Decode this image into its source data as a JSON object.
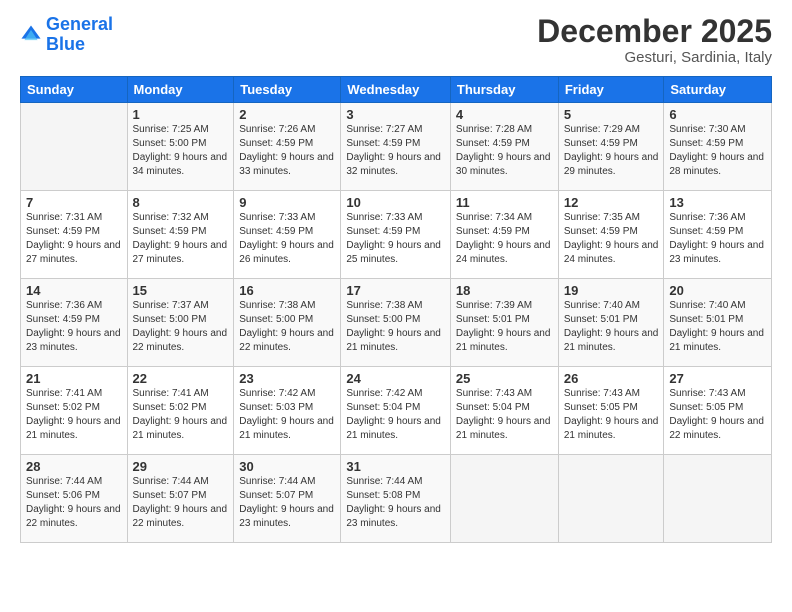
{
  "header": {
    "logo_line1": "General",
    "logo_line2": "Blue",
    "month_title": "December 2025",
    "location": "Gesturi, Sardinia, Italy"
  },
  "days_of_week": [
    "Sunday",
    "Monday",
    "Tuesday",
    "Wednesday",
    "Thursday",
    "Friday",
    "Saturday"
  ],
  "weeks": [
    [
      {
        "num": "",
        "sunrise": "",
        "sunset": "",
        "daylight": ""
      },
      {
        "num": "1",
        "sunrise": "Sunrise: 7:25 AM",
        "sunset": "Sunset: 5:00 PM",
        "daylight": "Daylight: 9 hours and 34 minutes."
      },
      {
        "num": "2",
        "sunrise": "Sunrise: 7:26 AM",
        "sunset": "Sunset: 4:59 PM",
        "daylight": "Daylight: 9 hours and 33 minutes."
      },
      {
        "num": "3",
        "sunrise": "Sunrise: 7:27 AM",
        "sunset": "Sunset: 4:59 PM",
        "daylight": "Daylight: 9 hours and 32 minutes."
      },
      {
        "num": "4",
        "sunrise": "Sunrise: 7:28 AM",
        "sunset": "Sunset: 4:59 PM",
        "daylight": "Daylight: 9 hours and 30 minutes."
      },
      {
        "num": "5",
        "sunrise": "Sunrise: 7:29 AM",
        "sunset": "Sunset: 4:59 PM",
        "daylight": "Daylight: 9 hours and 29 minutes."
      },
      {
        "num": "6",
        "sunrise": "Sunrise: 7:30 AM",
        "sunset": "Sunset: 4:59 PM",
        "daylight": "Daylight: 9 hours and 28 minutes."
      }
    ],
    [
      {
        "num": "7",
        "sunrise": "Sunrise: 7:31 AM",
        "sunset": "Sunset: 4:59 PM",
        "daylight": "Daylight: 9 hours and 27 minutes."
      },
      {
        "num": "8",
        "sunrise": "Sunrise: 7:32 AM",
        "sunset": "Sunset: 4:59 PM",
        "daylight": "Daylight: 9 hours and 27 minutes."
      },
      {
        "num": "9",
        "sunrise": "Sunrise: 7:33 AM",
        "sunset": "Sunset: 4:59 PM",
        "daylight": "Daylight: 9 hours and 26 minutes."
      },
      {
        "num": "10",
        "sunrise": "Sunrise: 7:33 AM",
        "sunset": "Sunset: 4:59 PM",
        "daylight": "Daylight: 9 hours and 25 minutes."
      },
      {
        "num": "11",
        "sunrise": "Sunrise: 7:34 AM",
        "sunset": "Sunset: 4:59 PM",
        "daylight": "Daylight: 9 hours and 24 minutes."
      },
      {
        "num": "12",
        "sunrise": "Sunrise: 7:35 AM",
        "sunset": "Sunset: 4:59 PM",
        "daylight": "Daylight: 9 hours and 24 minutes."
      },
      {
        "num": "13",
        "sunrise": "Sunrise: 7:36 AM",
        "sunset": "Sunset: 4:59 PM",
        "daylight": "Daylight: 9 hours and 23 minutes."
      }
    ],
    [
      {
        "num": "14",
        "sunrise": "Sunrise: 7:36 AM",
        "sunset": "Sunset: 4:59 PM",
        "daylight": "Daylight: 9 hours and 23 minutes."
      },
      {
        "num": "15",
        "sunrise": "Sunrise: 7:37 AM",
        "sunset": "Sunset: 5:00 PM",
        "daylight": "Daylight: 9 hours and 22 minutes."
      },
      {
        "num": "16",
        "sunrise": "Sunrise: 7:38 AM",
        "sunset": "Sunset: 5:00 PM",
        "daylight": "Daylight: 9 hours and 22 minutes."
      },
      {
        "num": "17",
        "sunrise": "Sunrise: 7:38 AM",
        "sunset": "Sunset: 5:00 PM",
        "daylight": "Daylight: 9 hours and 21 minutes."
      },
      {
        "num": "18",
        "sunrise": "Sunrise: 7:39 AM",
        "sunset": "Sunset: 5:01 PM",
        "daylight": "Daylight: 9 hours and 21 minutes."
      },
      {
        "num": "19",
        "sunrise": "Sunrise: 7:40 AM",
        "sunset": "Sunset: 5:01 PM",
        "daylight": "Daylight: 9 hours and 21 minutes."
      },
      {
        "num": "20",
        "sunrise": "Sunrise: 7:40 AM",
        "sunset": "Sunset: 5:01 PM",
        "daylight": "Daylight: 9 hours and 21 minutes."
      }
    ],
    [
      {
        "num": "21",
        "sunrise": "Sunrise: 7:41 AM",
        "sunset": "Sunset: 5:02 PM",
        "daylight": "Daylight: 9 hours and 21 minutes."
      },
      {
        "num": "22",
        "sunrise": "Sunrise: 7:41 AM",
        "sunset": "Sunset: 5:02 PM",
        "daylight": "Daylight: 9 hours and 21 minutes."
      },
      {
        "num": "23",
        "sunrise": "Sunrise: 7:42 AM",
        "sunset": "Sunset: 5:03 PM",
        "daylight": "Daylight: 9 hours and 21 minutes."
      },
      {
        "num": "24",
        "sunrise": "Sunrise: 7:42 AM",
        "sunset": "Sunset: 5:04 PM",
        "daylight": "Daylight: 9 hours and 21 minutes."
      },
      {
        "num": "25",
        "sunrise": "Sunrise: 7:43 AM",
        "sunset": "Sunset: 5:04 PM",
        "daylight": "Daylight: 9 hours and 21 minutes."
      },
      {
        "num": "26",
        "sunrise": "Sunrise: 7:43 AM",
        "sunset": "Sunset: 5:05 PM",
        "daylight": "Daylight: 9 hours and 21 minutes."
      },
      {
        "num": "27",
        "sunrise": "Sunrise: 7:43 AM",
        "sunset": "Sunset: 5:05 PM",
        "daylight": "Daylight: 9 hours and 22 minutes."
      }
    ],
    [
      {
        "num": "28",
        "sunrise": "Sunrise: 7:44 AM",
        "sunset": "Sunset: 5:06 PM",
        "daylight": "Daylight: 9 hours and 22 minutes."
      },
      {
        "num": "29",
        "sunrise": "Sunrise: 7:44 AM",
        "sunset": "Sunset: 5:07 PM",
        "daylight": "Daylight: 9 hours and 22 minutes."
      },
      {
        "num": "30",
        "sunrise": "Sunrise: 7:44 AM",
        "sunset": "Sunset: 5:07 PM",
        "daylight": "Daylight: 9 hours and 23 minutes."
      },
      {
        "num": "31",
        "sunrise": "Sunrise: 7:44 AM",
        "sunset": "Sunset: 5:08 PM",
        "daylight": "Daylight: 9 hours and 23 minutes."
      },
      {
        "num": "",
        "sunrise": "",
        "sunset": "",
        "daylight": ""
      },
      {
        "num": "",
        "sunrise": "",
        "sunset": "",
        "daylight": ""
      },
      {
        "num": "",
        "sunrise": "",
        "sunset": "",
        "daylight": ""
      }
    ]
  ]
}
